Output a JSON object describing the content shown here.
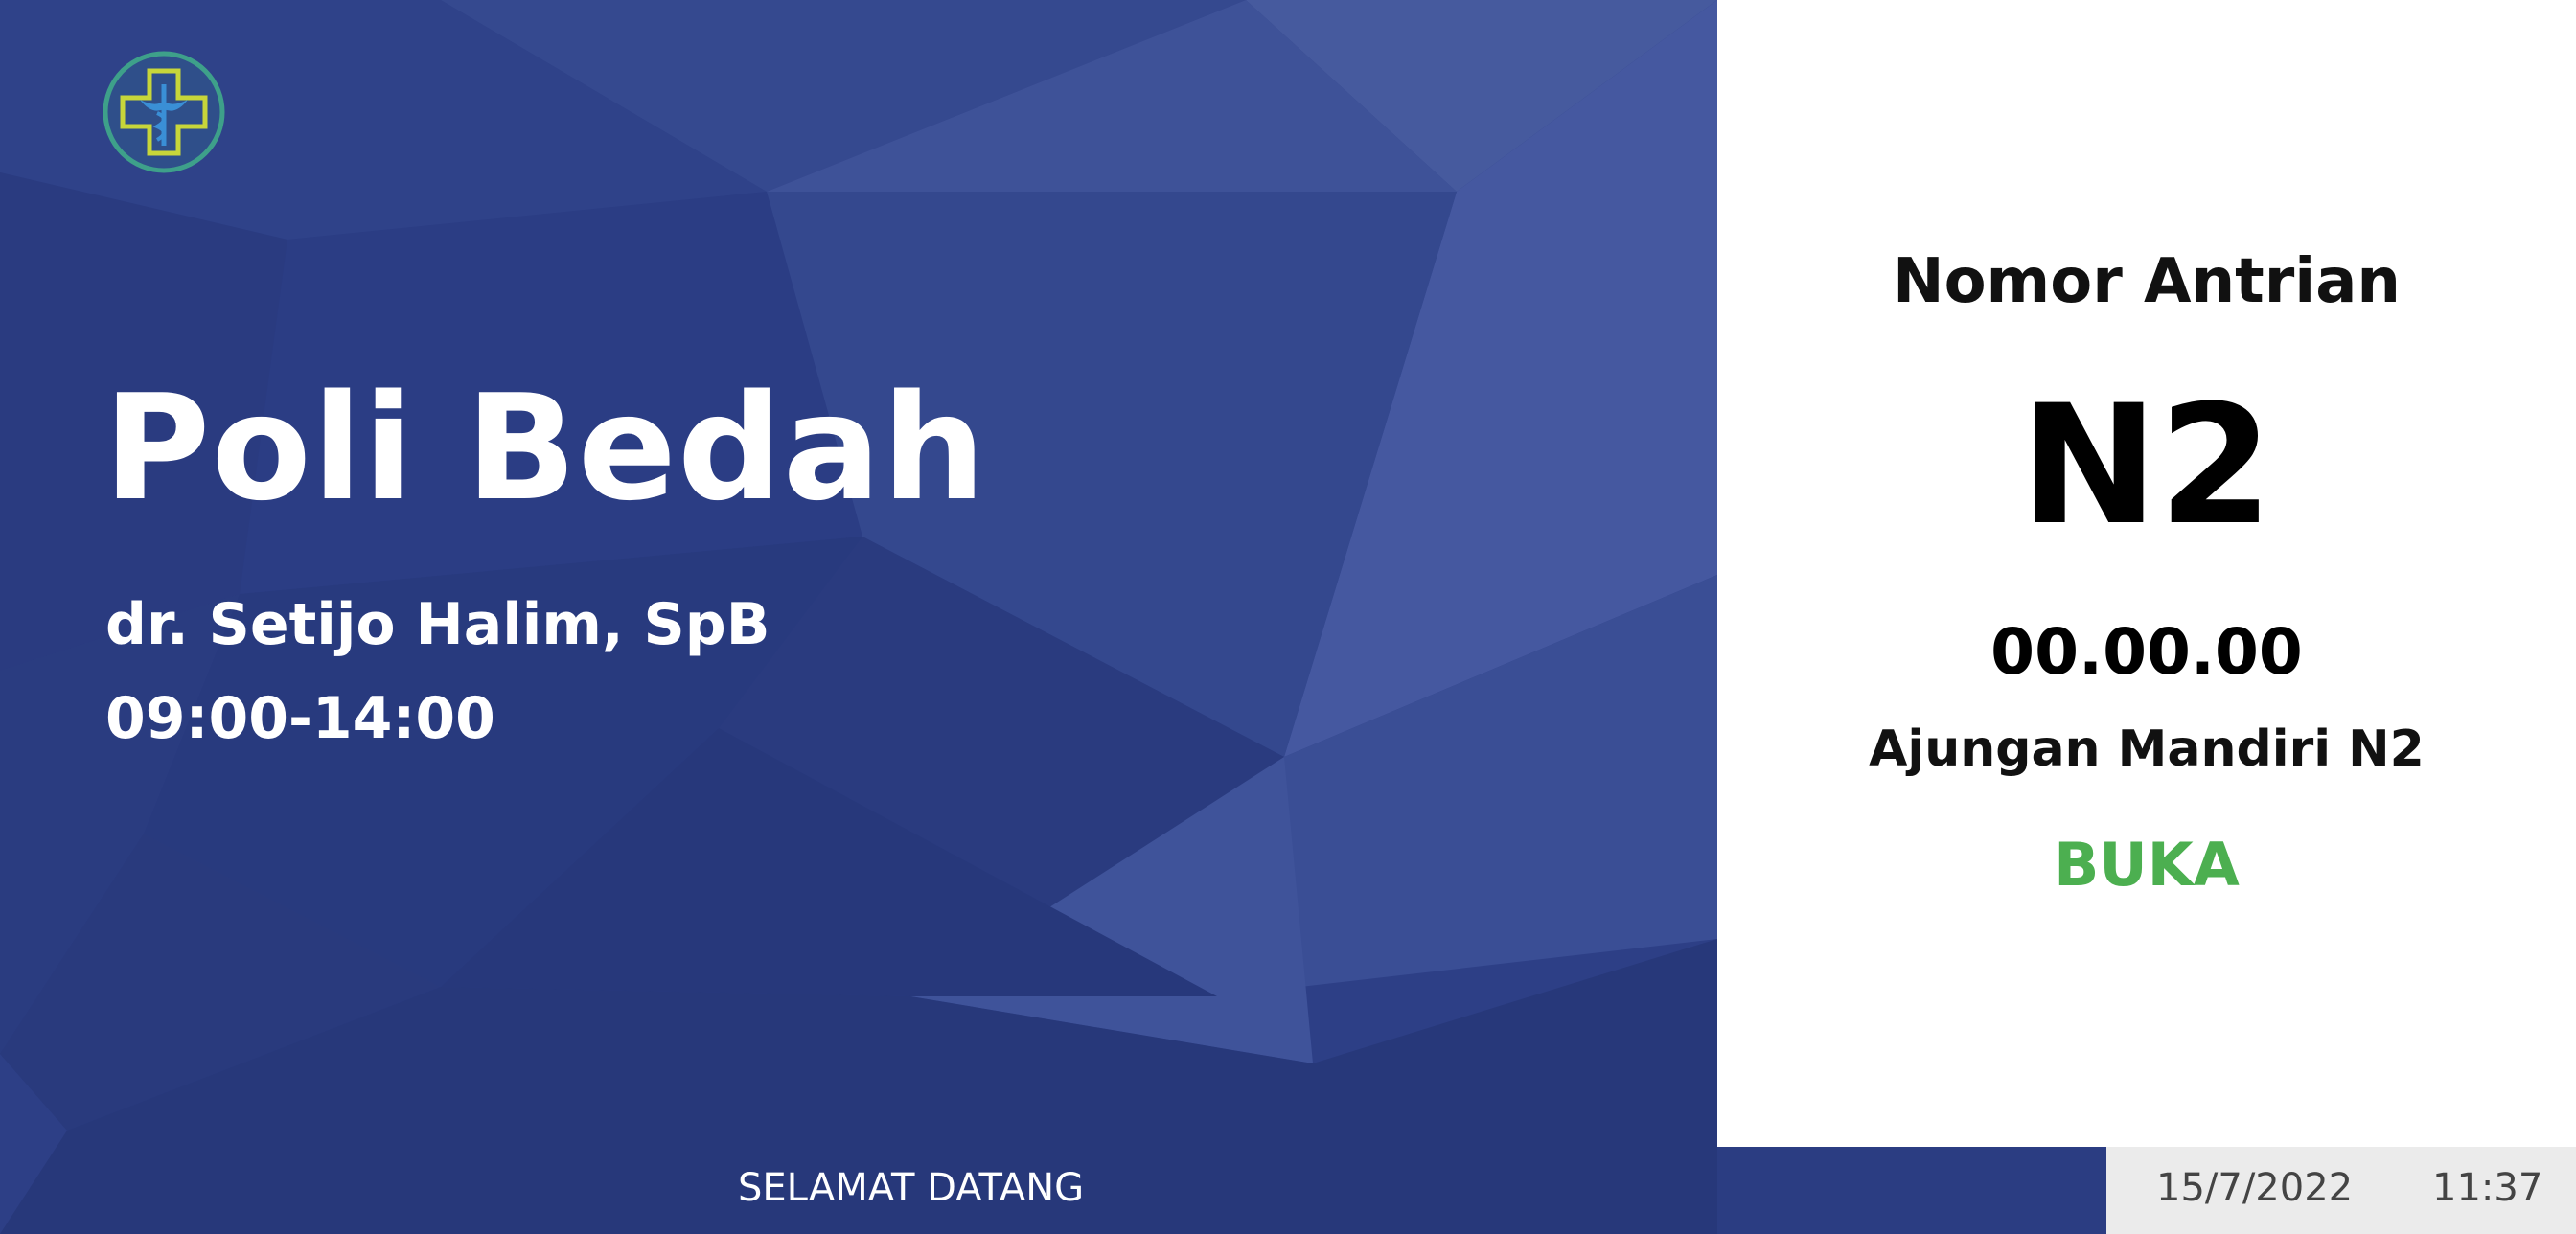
{
  "clinic": {
    "name": "Poli Bedah",
    "doctor": "dr. Setijo Halim, SpB",
    "schedule": "09:00-14:00",
    "logo_icon": "medical-cross-caduceus-icon"
  },
  "queue": {
    "label": "Nomor Antrian",
    "number": "N2",
    "time": "00.00.00",
    "counter": "Ajungan Mandiri N2",
    "status": "BUKA"
  },
  "footer": {
    "marquee": "SELAMAT DATANG",
    "date": "15/7/2022",
    "time": "11:37"
  },
  "colors": {
    "background_blue": "#2d3f86",
    "panel_white": "#ffffff",
    "status_green": "#4caf50",
    "logo_outer": "#2e7d8c",
    "logo_cross": "#c7d63a",
    "logo_symbol": "#3a8fd6",
    "clock_box": "#ebebeb"
  }
}
